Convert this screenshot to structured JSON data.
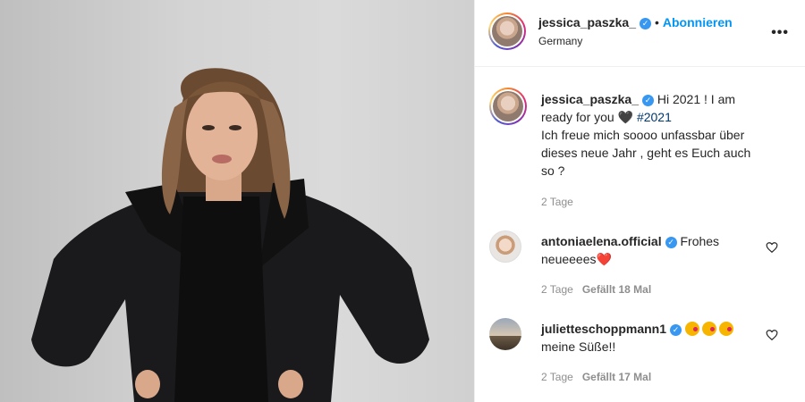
{
  "post": {
    "author": "jessica_paszka_",
    "follow_label": "Abonnieren",
    "location": "Germany",
    "separator": "•",
    "caption": {
      "author": "jessica_paszka_",
      "text_before": "Hi 2021 ! I am ready for you",
      "heart": "🖤",
      "hashtag": "#2021",
      "text_after": "Ich freue mich soooo unfassbar über dieses neue Jahr , geht es Euch auch so ?",
      "time": "2 Tage"
    }
  },
  "comments": [
    {
      "author": "antoniaelena.official",
      "text": "Frohes neueeees",
      "emoji": "❤️",
      "time": "2 Tage",
      "likes": "Gefällt 18 Mal"
    },
    {
      "author": "julietteschoppmann1",
      "text": "meine Süße!!",
      "time": "2 Tage",
      "likes": "Gefällt 17 Mal"
    }
  ],
  "icons": {
    "verified": "verified-badge-icon",
    "more": "more-options-icon",
    "like": "heart-outline-icon"
  },
  "colors": {
    "link_blue": "#0095f6",
    "verified_blue": "#3897f0",
    "muted": "#8e8e8e",
    "hashtag": "#00376b"
  }
}
